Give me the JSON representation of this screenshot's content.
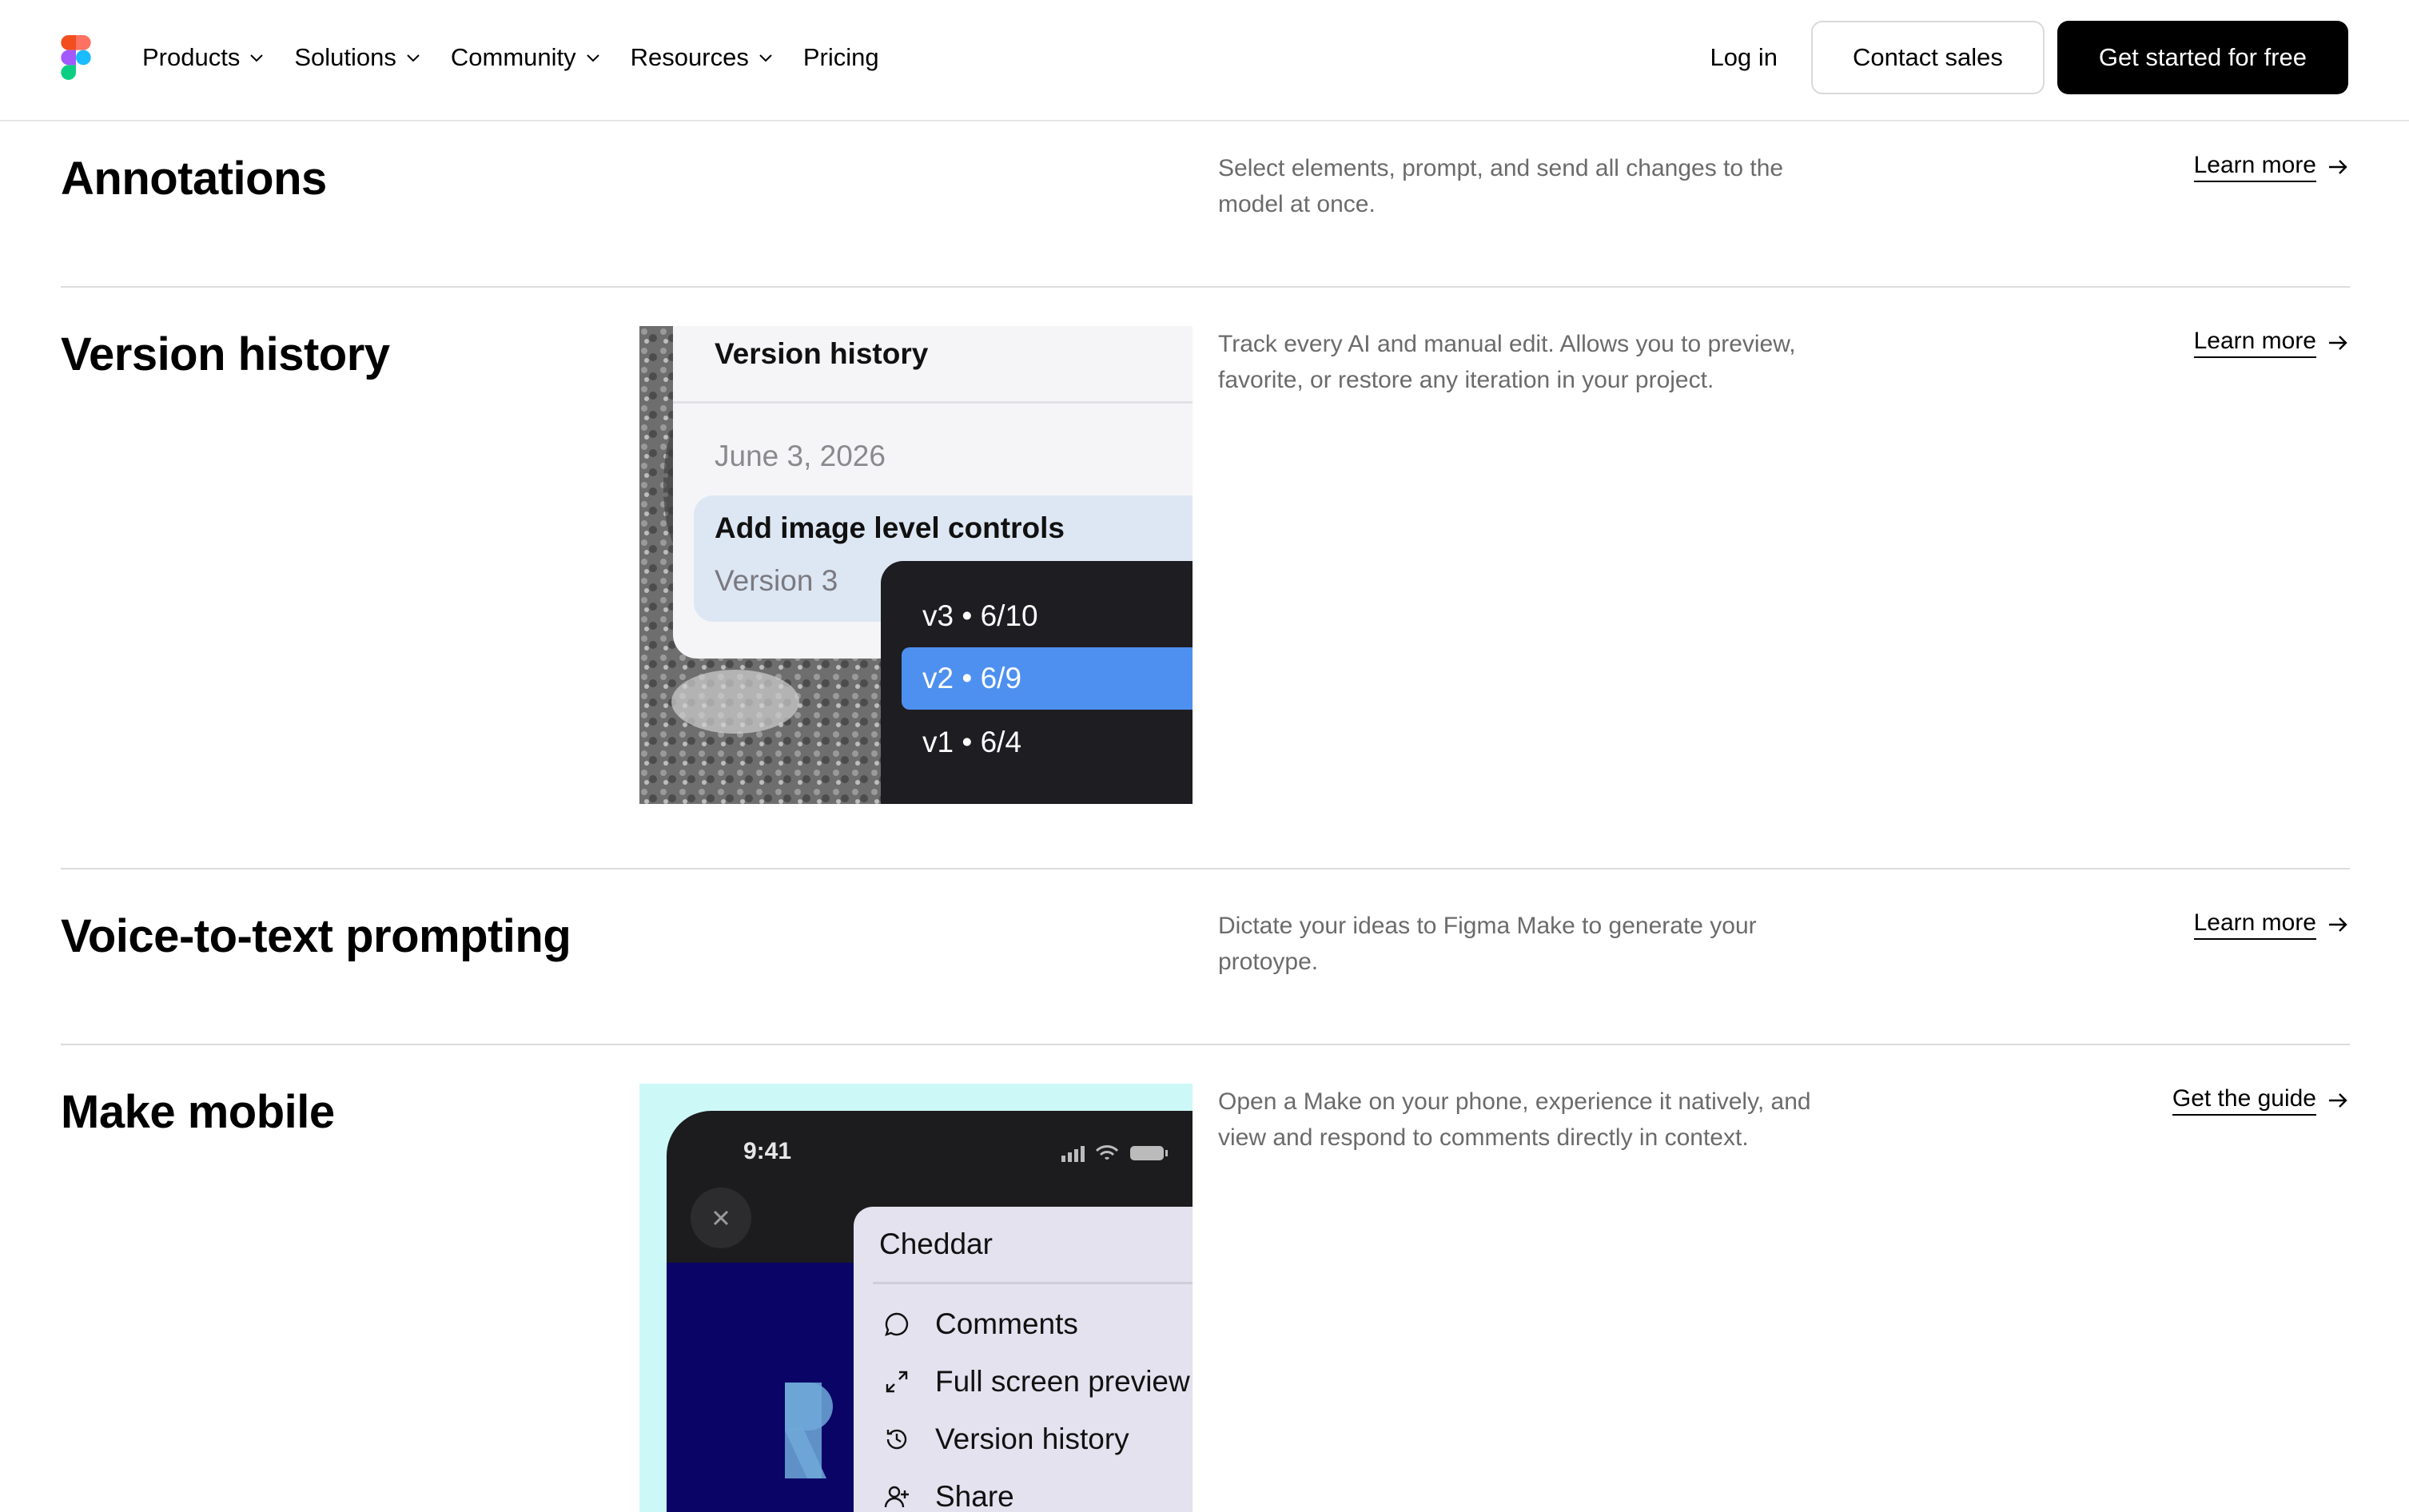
{
  "nav": {
    "items": [
      {
        "label": "Products",
        "dropdown": true
      },
      {
        "label": "Solutions",
        "dropdown": true
      },
      {
        "label": "Community",
        "dropdown": true
      },
      {
        "label": "Resources",
        "dropdown": true
      },
      {
        "label": "Pricing",
        "dropdown": false
      }
    ],
    "login": "Log in",
    "contact": "Contact sales",
    "cta": "Get started for free"
  },
  "rows": {
    "annotations": {
      "title": "Annotations",
      "desc": "Select elements, prompt, and send all changes to the model at once.",
      "link": "Learn more"
    },
    "version_history": {
      "title": "Version history",
      "desc": "Track every AI and manual edit. Allows you to preview, favorite, or restore any iteration in your project.",
      "link": "Learn more",
      "image": {
        "card_title": "Version history",
        "date": "June 3, 2026",
        "item_title": "Add image level controls",
        "item_sub": "Version 3",
        "versions": [
          "v3 • 6/10",
          "v2 • 6/9",
          "v1 • 6/4"
        ],
        "selected_version": "v2 • 6/9"
      }
    },
    "voice": {
      "title": "Voice-to-text prompting",
      "desc": "Dictate your ideas to Figma Make to generate your protoype.",
      "link": "Learn more"
    },
    "mobile": {
      "title": "Make mobile",
      "desc": "Open a Make on your phone, experience it natively, and view and respond to comments directly in context.",
      "link": "Get the guide",
      "image": {
        "time": "9:41",
        "menu_title": "Cheddar",
        "options": [
          "Comments",
          "Full screen preview",
          "Version history",
          "Share"
        ]
      }
    }
  },
  "colors": {
    "accent_blue": "#4d90ef",
    "cta_bg": "#000000",
    "muted_text": "#6b6b6b"
  }
}
